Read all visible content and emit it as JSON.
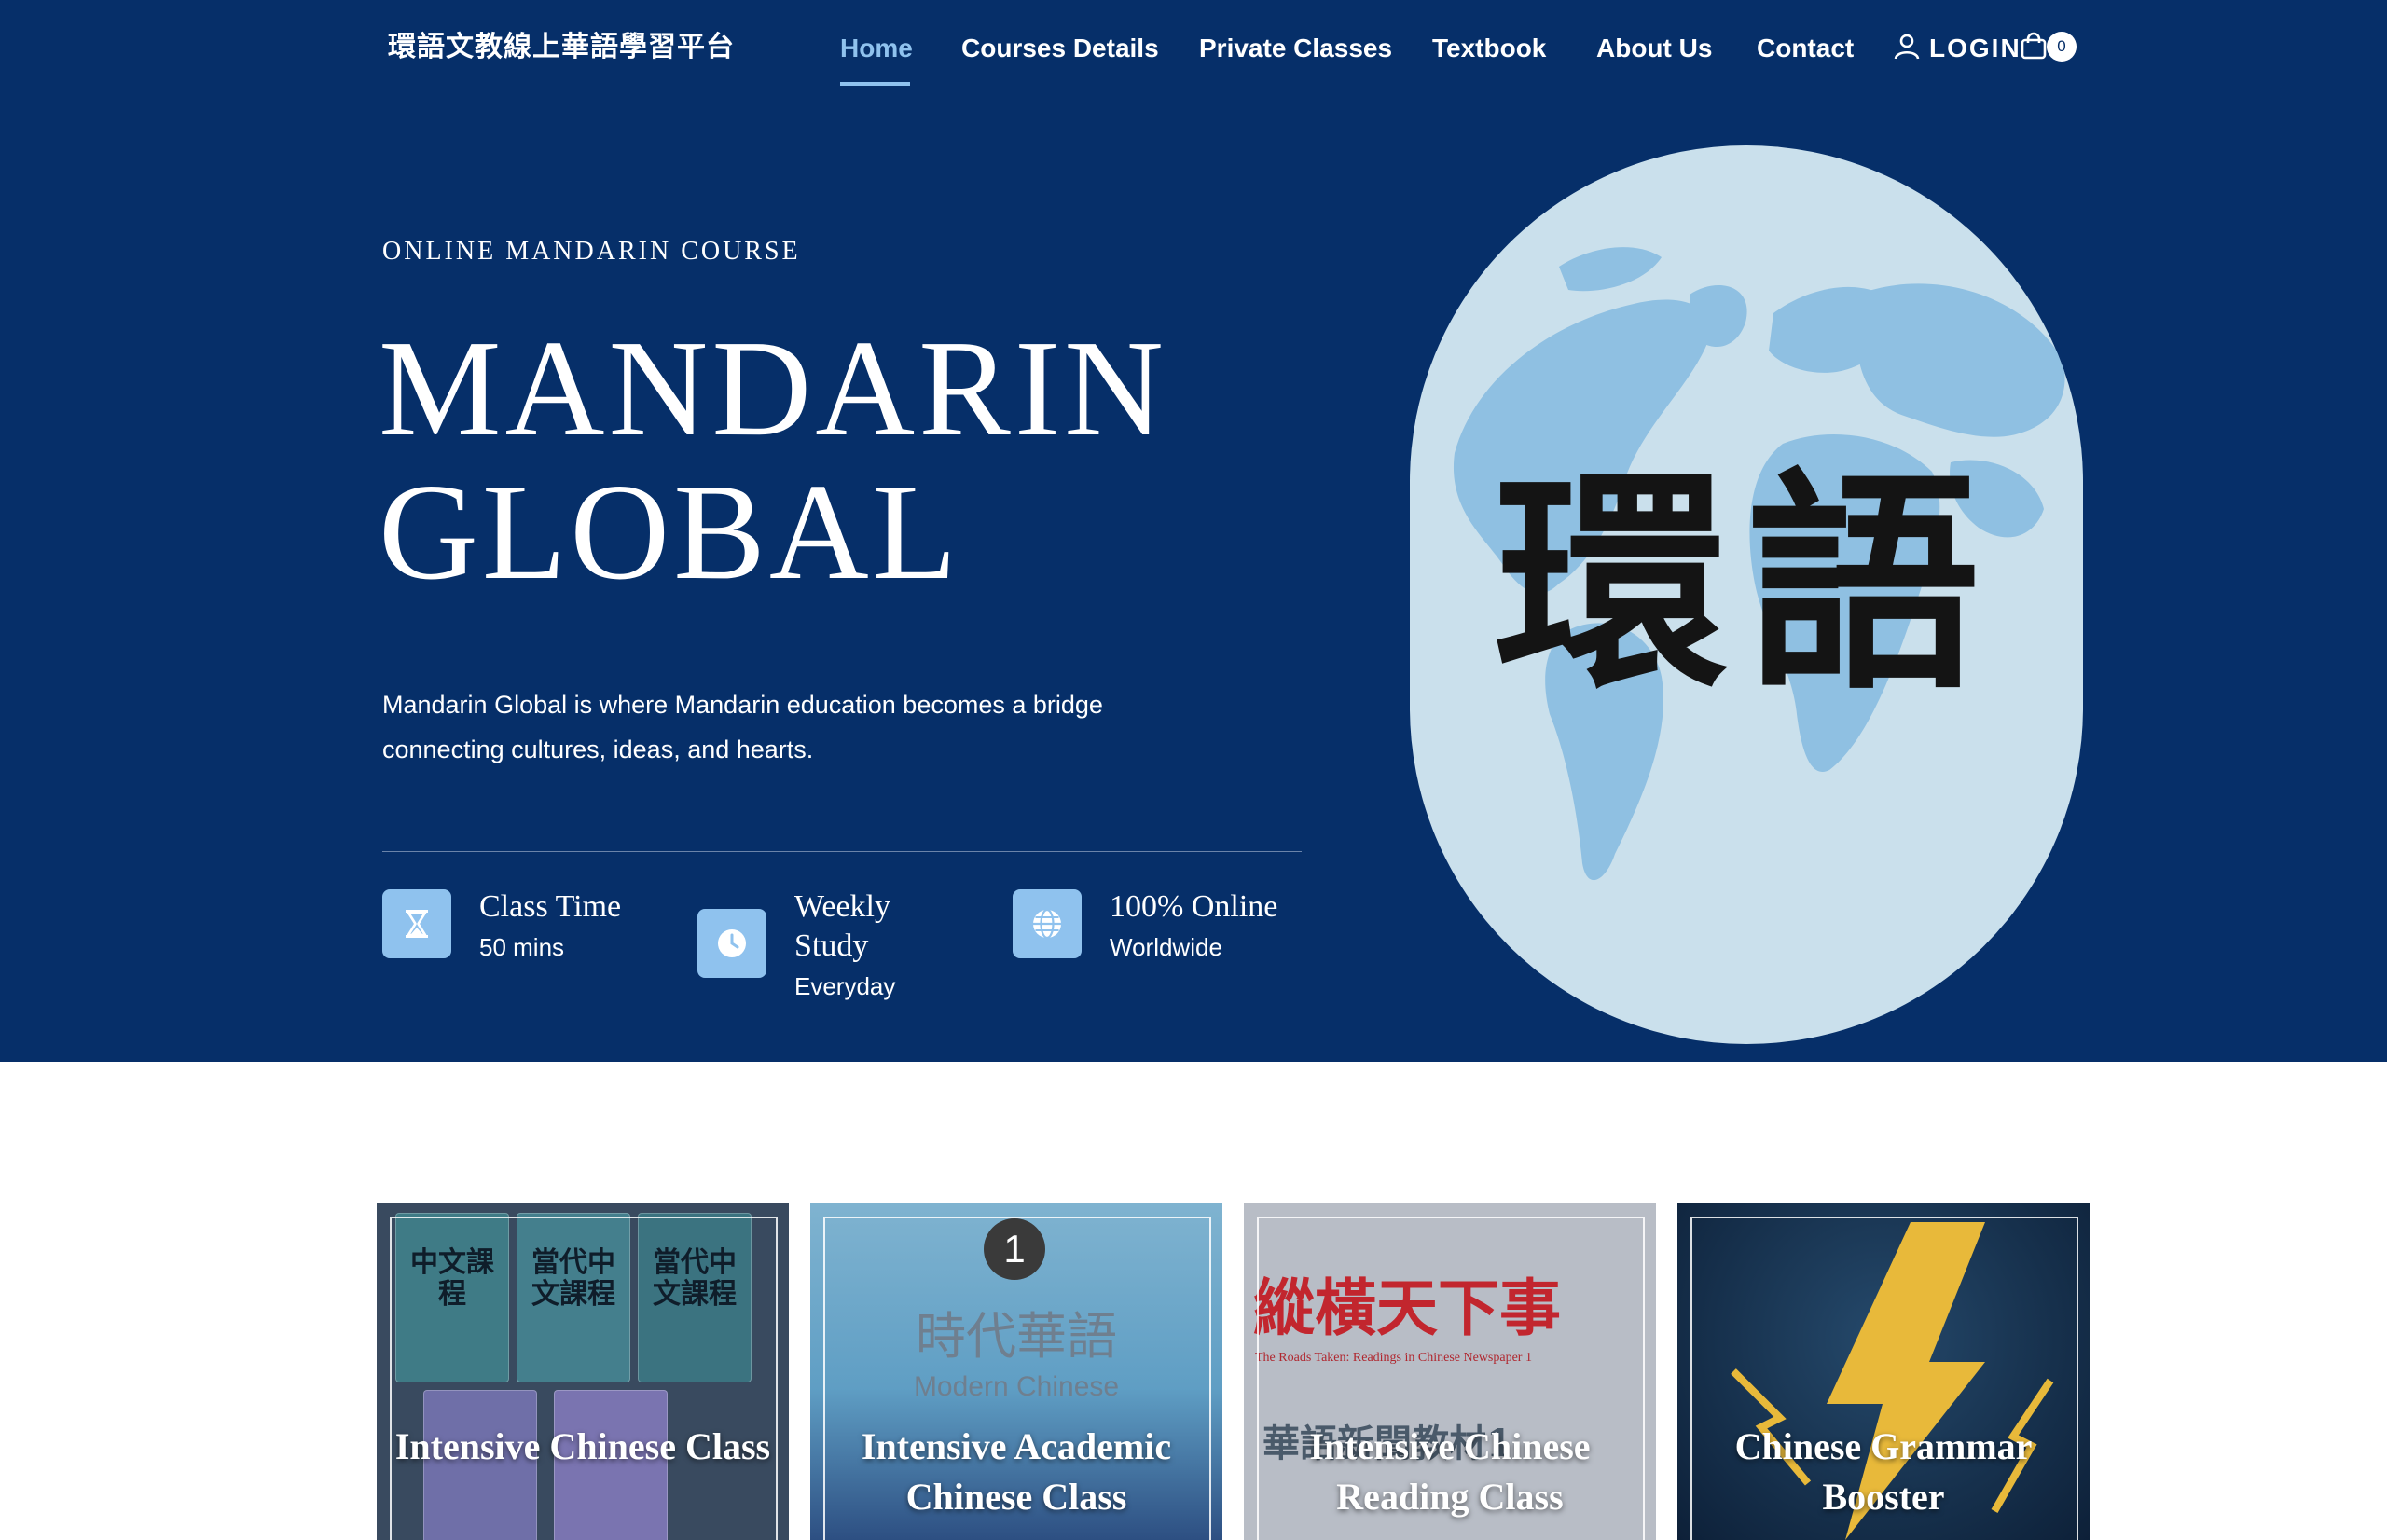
{
  "header": {
    "brand": "環語文教線上華語學習平台",
    "nav": [
      {
        "label": "Home",
        "active": true
      },
      {
        "label": "Courses Details"
      },
      {
        "label": "Private Classes"
      },
      {
        "label": "Textbook"
      },
      {
        "label": "About Us"
      },
      {
        "label": "Contact"
      }
    ],
    "login_label": "LOGIN",
    "cart_count": "0"
  },
  "hero": {
    "eyebrow": "ONLINE MANDARIN COURSE",
    "title_line1": "MANDARIN",
    "title_line2": "GLOBAL",
    "description": "Mandarin Global is where Mandarin education becomes a bridge connecting cultures, ideas, and hearts.",
    "features": [
      {
        "icon": "hourglass-icon",
        "title": "Class Time",
        "subtitle": "50 mins"
      },
      {
        "icon": "clock-icon",
        "title": "Weekly Study",
        "subtitle": "Everyday"
      },
      {
        "icon": "globe-icon",
        "title": "100% Online",
        "subtitle": "Worldwide"
      }
    ],
    "logo_text": "環語"
  },
  "courses": [
    {
      "title": "Intensive Chinese Class",
      "cover_text": [
        "當代中文課程",
        "中文課程"
      ]
    },
    {
      "title": "Intensive Academic Chinese Class",
      "cover_text": [
        "1",
        "時代華語",
        "Modern Chinese"
      ]
    },
    {
      "title": "Intensive Chinese Reading Class",
      "cover_text": [
        "縱橫天下事",
        "The Roads Taken: Readings in Chinese Newspaper 1",
        "華語新聞教材1"
      ]
    },
    {
      "title": "Chinese Grammar Booster",
      "cover_text": []
    }
  ],
  "colors": {
    "hero_bg": "#062f69",
    "accent": "#8fc2ee",
    "art_bg": "#cae0ec",
    "continents": "#8fc0e2"
  }
}
